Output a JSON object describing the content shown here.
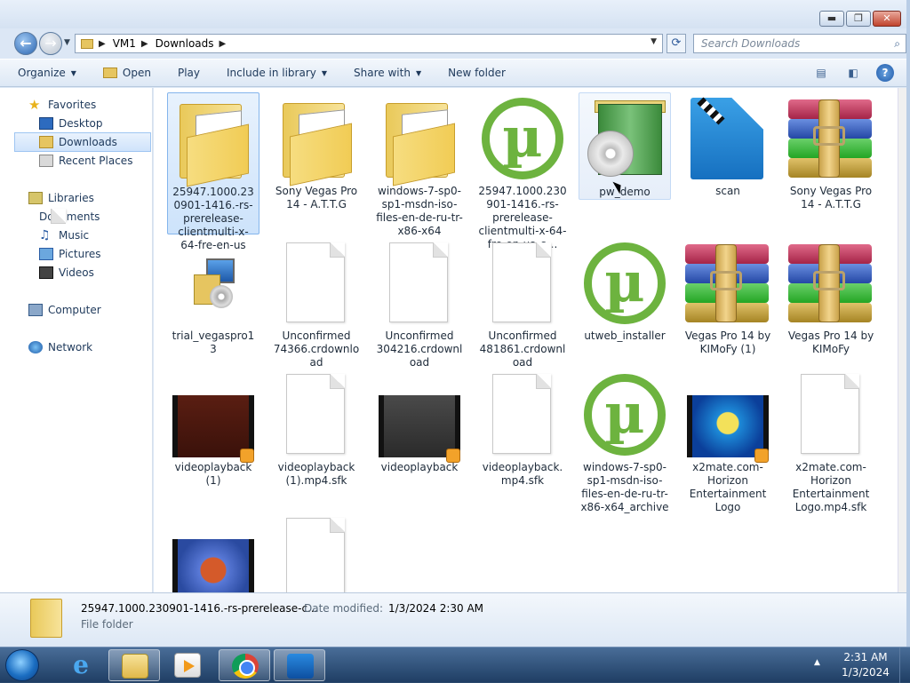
{
  "window": {
    "minimize": "▬",
    "maximize": "❐",
    "close": "✕"
  },
  "address": {
    "crumbs": [
      "VM1",
      "Downloads"
    ],
    "search_placeholder": "Search Downloads"
  },
  "toolbar": {
    "organize": "Organize",
    "open": "Open",
    "play": "Play",
    "include": "Include in library",
    "share": "Share with",
    "newfolder": "New folder"
  },
  "nav": {
    "favorites": "Favorites",
    "desktop": "Desktop",
    "downloads": "Downloads",
    "recent": "Recent Places",
    "libraries": "Libraries",
    "documents": "Documents",
    "music": "Music",
    "pictures": "Pictures",
    "videos": "Videos",
    "computer": "Computer",
    "network": "Network"
  },
  "files": [
    {
      "name": "25947.1000.230901-1416.-rs-prerelease-clientmulti-x-64-fre-en-us",
      "icon": "folder-icon"
    },
    {
      "name": "Sony Vegas Pro 14 - A.T.T.G",
      "icon": "folder-icon"
    },
    {
      "name": "windows-7-sp0-sp1-msdn-iso-files-en-de-ru-tr-x86-x64",
      "icon": "folder-icon"
    },
    {
      "name": "25947.1000.230901-1416.-rs-prerelease-clientmulti-x-64-fre-en-us_a...",
      "icon": "utorrent-icon"
    },
    {
      "name": "pw_demo",
      "icon": "installer-box-icon"
    },
    {
      "name": "scan",
      "icon": "vegas-icon"
    },
    {
      "name": "Sony Vegas Pro 14 - A.T.T.G",
      "icon": "winrar-icon"
    },
    {
      "name": "trial_vegaspro13",
      "icon": "setup-icon"
    },
    {
      "name": "Unconfirmed 74366.crdownload",
      "icon": "blank-file-icon"
    },
    {
      "name": "Unconfirmed 304216.crdownload",
      "icon": "blank-file-icon"
    },
    {
      "name": "Unconfirmed 481861.crdownload",
      "icon": "blank-file-icon"
    },
    {
      "name": "utweb_installer",
      "icon": "utorrent-icon"
    },
    {
      "name": "Vegas Pro 14 by KIMoFy (1)",
      "icon": "winrar-icon"
    },
    {
      "name": "Vegas Pro 14 by KIMoFy",
      "icon": "winrar-icon"
    },
    {
      "name": "videoplayback (1)",
      "icon": "video-thumb-icon"
    },
    {
      "name": "videoplayback (1).mp4.sfk",
      "icon": "blank-file-icon"
    },
    {
      "name": "videoplayback",
      "icon": "video-thumb-icon"
    },
    {
      "name": "videoplayback.mp4.sfk",
      "icon": "blank-file-icon"
    },
    {
      "name": "windows-7-sp0-sp1-msdn-iso-files-en-de-ru-tr-x86-x64_archive",
      "icon": "utorrent-icon"
    },
    {
      "name": "x2mate.com-Horizon Entertainment Logo",
      "icon": "video-thumb-icon"
    },
    {
      "name": "x2mate.com-Horizon Entertainment Logo.mp4.sfk",
      "icon": "blank-file-icon"
    },
    {
      "name": "",
      "icon": "video-thumb-icon"
    },
    {
      "name": "",
      "icon": "blank-file-icon"
    }
  ],
  "status": {
    "name": "25947.1000.230901-1416.-rs-prerelease-c...",
    "modified_label": "Date modified:",
    "modified_value": "1/3/2024 2:30 AM",
    "type": "File folder"
  },
  "taskbar": {
    "time": "2:31 AM",
    "date": "1/3/2024"
  },
  "colors": {
    "accent": "#2a64b0",
    "selection": "#cde3fb",
    "taskbar": "#1f3e64"
  }
}
